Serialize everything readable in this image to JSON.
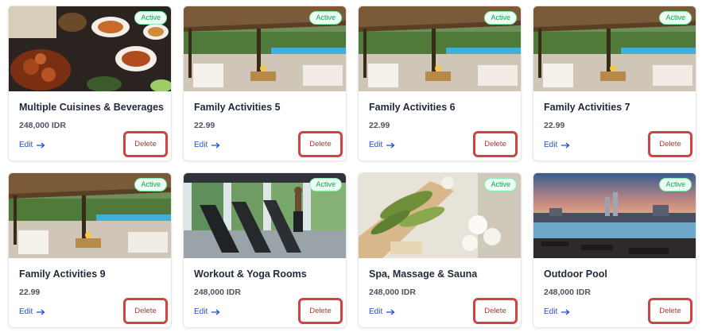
{
  "colors": {
    "accent_link": "#1d4ed8",
    "delete_red": "#d14343",
    "active_green": "#16a34a"
  },
  "cards": [
    {
      "title": "Multiple Cuisines & Beverages",
      "price": "248,000 IDR",
      "status": "Active",
      "edit_label": "Edit",
      "delete_label": "Delete",
      "image": "food"
    },
    {
      "title": "Family Activities 5",
      "price": "22.99",
      "status": "Active",
      "edit_label": "Edit",
      "delete_label": "Delete",
      "image": "pavilion"
    },
    {
      "title": "Family Activities 6",
      "price": "22.99",
      "status": "Active",
      "edit_label": "Edit",
      "delete_label": "Delete",
      "image": "pavilion"
    },
    {
      "title": "Family Activities 7",
      "price": "22.99",
      "status": "Active",
      "edit_label": "Edit",
      "delete_label": "Delete",
      "image": "pavilion"
    },
    {
      "title": "Family Activities 9",
      "price": "22.99",
      "status": "Active",
      "edit_label": "Edit",
      "delete_label": "Delete",
      "image": "pavilion"
    },
    {
      "title": "Workout & Yoga Rooms",
      "price": "248,000 IDR",
      "status": "Active",
      "edit_label": "Edit",
      "delete_label": "Delete",
      "image": "gym"
    },
    {
      "title": "Spa, Massage & Sauna",
      "price": "248,000 IDR",
      "status": "Active",
      "edit_label": "Edit",
      "delete_label": "Delete",
      "image": "spa"
    },
    {
      "title": "Outdoor Pool",
      "price": "248,000 IDR",
      "status": "Active",
      "edit_label": "Edit",
      "delete_label": "Delete",
      "image": "pool"
    }
  ]
}
